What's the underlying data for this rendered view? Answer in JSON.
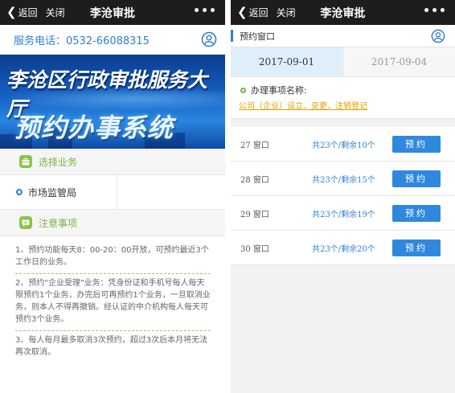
{
  "left": {
    "nav": {
      "back_label": "返回",
      "close_label": "关闭",
      "title": "李沧审批",
      "more_label": "•••"
    },
    "phone": "服务电话：0532-66088315",
    "banner": {
      "line1": "李沧区行政审批服务大厅",
      "line2": "预约办事系统"
    },
    "select_business_label": "选择业务",
    "bureau_label": "市场监管局",
    "notice_label": "注意事项",
    "notes": [
      "1、预约功能每天8：00-20：00开放，可预约最近3个工作日的业务。",
      "2、预约\"企业受理\"业务：凭身份证和手机号每人每天限预约1个业务，办完后可再预约1个业务，一旦取消业务，则本人不得再撤销。经认证的中介机构每人每天可预约3个业务。",
      "3、每人每月最多取消3次预约，超过3次后本月将无法再次取消。"
    ]
  },
  "right": {
    "nav": {
      "back_label": "返回",
      "close_label": "关闭",
      "title": "李沧审批",
      "more_label": "•••"
    },
    "header_title": "预约窗口",
    "dates": [
      "2017-09-01",
      "2017-09-04"
    ],
    "item_label": "办理事项名称:",
    "item_value": "公司（企业）设立、变更、注销登记",
    "windows": [
      {
        "name": "27 窗口",
        "stock": "共23个/剩余10个",
        "button": "预约"
      },
      {
        "name": "28 窗口",
        "stock": "共23个/剩余15个",
        "button": "预约"
      },
      {
        "name": "29 窗口",
        "stock": "共23个/剩余19个",
        "button": "预约"
      },
      {
        "name": "30 窗口",
        "stock": "共23个/剩余20个",
        "button": "预约"
      }
    ]
  },
  "colors": {
    "brand_blue": "#2f7fd1",
    "green": "#8bc34a",
    "link_orange": "#e0a000",
    "nav_bg": "#1d1d1f"
  },
  "icons": [
    "chevron-left-icon",
    "more-icon",
    "user-icon",
    "briefcase-icon",
    "notice-icon"
  ]
}
